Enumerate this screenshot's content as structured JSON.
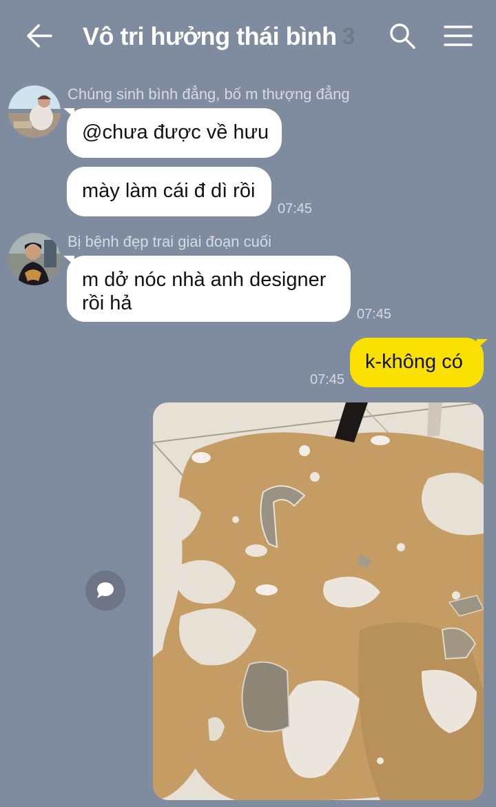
{
  "header": {
    "title": "Vô tri hưởng thái bình",
    "member_count": "3"
  },
  "messages": [
    {
      "sender": "Chúng sinh bình đẳng, bố m thượng đẳng",
      "text": "@chưa được về hưu"
    },
    {
      "text": "mày làm cái đ dì rồi",
      "time": "07:45"
    },
    {
      "sender": "Bị bệnh đẹp trai giai đoạn cuối",
      "text_line1": "m dở nóc nhà anh designer",
      "text_line2": "rồi hả",
      "time": "07:45"
    },
    {
      "text": "k-không có",
      "time": "07:45"
    }
  ],
  "colors": {
    "background": "#7f8b9f",
    "incoming_bubble": "#ffffff",
    "outgoing_bubble": "#f9e000",
    "meta_text": "#d5dbe4"
  },
  "icons": {
    "back": "arrow-left-icon",
    "search": "search-icon",
    "menu": "hamburger-menu-icon",
    "share": "speech-bubble-icon"
  }
}
